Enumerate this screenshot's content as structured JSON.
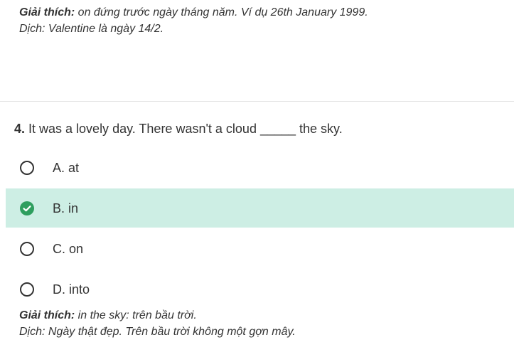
{
  "explanation_prev": {
    "label": "Giải thích:",
    "text": " on đứng trước ngày tháng năm. Ví dụ 26th January 1999.",
    "translation": "Dịch: Valentine là ngày 14/2."
  },
  "question": {
    "number": "4.",
    "text": " It was a lovely day. There wasn't a cloud _____ the sky."
  },
  "options": [
    {
      "label": "A. at",
      "selected": false
    },
    {
      "label": "B. in",
      "selected": true
    },
    {
      "label": "C. on",
      "selected": false
    },
    {
      "label": "D. into",
      "selected": false
    }
  ],
  "explanation": {
    "label": "Giải thích:",
    "text": " in the sky: trên bầu trời.",
    "translation": "Dịch: Ngày thật đẹp. Trên bầu trời không một gợn mây."
  },
  "colors": {
    "selected_bg": "#cdeee4",
    "check_green": "#2e9e5e",
    "text": "#333333"
  },
  "icons": {
    "unselected": "radio-empty-icon",
    "selected": "check-circle-icon"
  }
}
